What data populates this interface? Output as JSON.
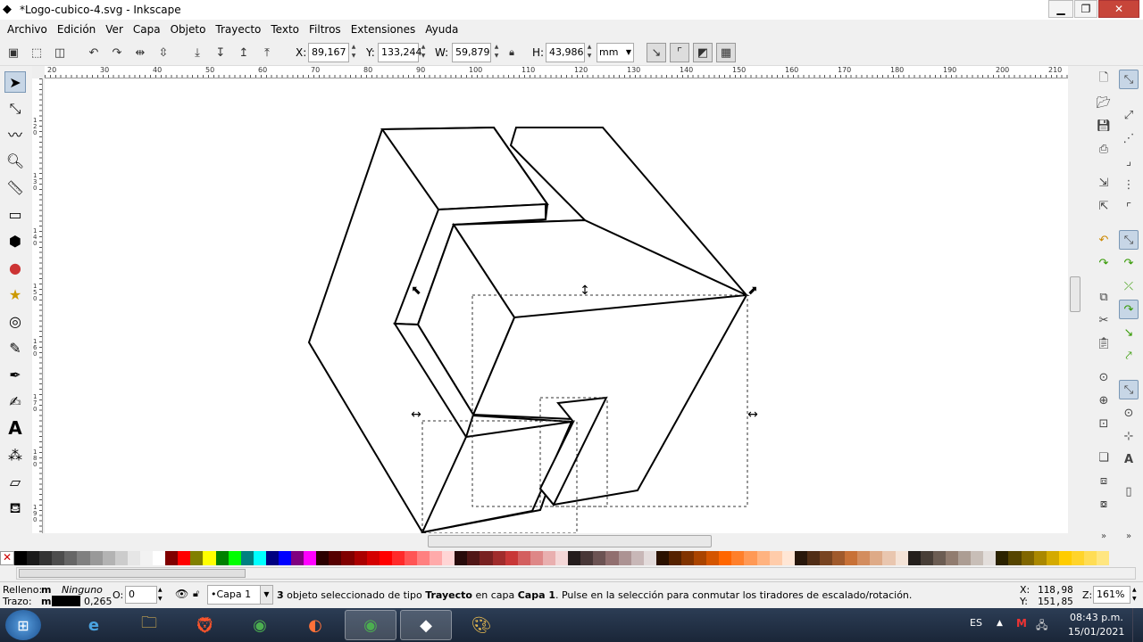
{
  "window": {
    "title": "*Logo-cubico-4.svg - Inkscape"
  },
  "menu": [
    "Archivo",
    "Edición",
    "Ver",
    "Capa",
    "Objeto",
    "Trayecto",
    "Texto",
    "Filtros",
    "Extensiones",
    "Ayuda"
  ],
  "toolctl": {
    "x_label": "X:",
    "x_value": "89,167",
    "y_label": "Y:",
    "y_value": "133,244",
    "w_label": "W:",
    "w_value": "59,879",
    "h_label": "H:",
    "h_value": "43,986",
    "unit": "mm"
  },
  "ruler": {
    "h_labels": [
      "20",
      "30",
      "40",
      "50",
      "60",
      "70",
      "80",
      "90",
      "100",
      "110",
      "120",
      "130",
      "140",
      "150",
      "160",
      "170",
      "180",
      "190",
      "200",
      "210"
    ],
    "v_labels": [
      "120",
      "130",
      "140",
      "150",
      "160",
      "170",
      "180",
      "190"
    ]
  },
  "palette_colors": [
    "#000000",
    "#1a1a1a",
    "#333333",
    "#4d4d4d",
    "#666666",
    "#808080",
    "#999999",
    "#b3b3b3",
    "#cccccc",
    "#e6e6e6",
    "#f2f2f2",
    "#ffffff",
    "#800000",
    "#ff0000",
    "#808000",
    "#ffff00",
    "#008000",
    "#00ff00",
    "#008080",
    "#00ffff",
    "#000080",
    "#0000ff",
    "#800080",
    "#ff00ff",
    "#2b0000",
    "#550000",
    "#800000",
    "#aa0000",
    "#d40000",
    "#ff0000",
    "#ff2a2a",
    "#ff5555",
    "#ff8080",
    "#ffaaaa",
    "#ffd5d5",
    "#280b0b",
    "#501616",
    "#782121",
    "#a02c2c",
    "#c83737",
    "#d35f5f",
    "#de8787",
    "#e9afaf",
    "#f4d7d7",
    "#241c1c",
    "#483737",
    "#6c5353",
    "#916f6f",
    "#ac9393",
    "#c8b7b7",
    "#e3dbdb",
    "#2b1100",
    "#552200",
    "#803300",
    "#aa4400",
    "#d45500",
    "#ff6600",
    "#ff7f2a",
    "#ff9955",
    "#ffb380",
    "#ffccaa",
    "#ffe6d5",
    "#28170b",
    "#502d16",
    "#784421",
    "#a05a2c",
    "#c87137",
    "#d38d5f",
    "#deaa87",
    "#e9c6af",
    "#f4e3d7",
    "#241f1c",
    "#483e37",
    "#6c5d53",
    "#917c6f",
    "#ac9d93",
    "#c8beb7",
    "#e3dedb",
    "#2b2200",
    "#554400",
    "#806600",
    "#aa8800",
    "#d4aa00",
    "#ffcc00",
    "#ffd42a",
    "#ffdd55",
    "#ffe680"
  ],
  "status": {
    "fill_label": "Relleno:",
    "fill_value": "m",
    "fill_none": "Ninguno",
    "stroke_label": "Trazo:",
    "stroke_value": "m",
    "stroke_width": "0,265",
    "opacity_label": "O:",
    "opacity_value": "0",
    "layer": "•Capa 1",
    "message_count": "3",
    "message_part1": " objeto seleccionado de tipo ",
    "message_type": "Trayecto",
    "message_part2": " en capa ",
    "message_layer": "Capa 1",
    "message_part3": ". Pulse en la selección para conmutar los tiradores de escalado/rotación.",
    "cursor_x_label": "X:",
    "cursor_x": "118,98",
    "cursor_y_label": "Y:",
    "cursor_y": "151,85",
    "zoom_label": "Z:",
    "zoom_value": "161%"
  },
  "taskbar": {
    "lang": "ES",
    "time": "08:43 p.m.",
    "date": "15/01/2021"
  }
}
